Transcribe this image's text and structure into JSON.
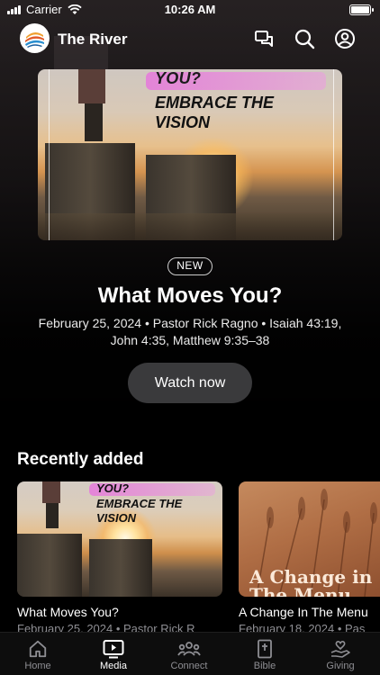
{
  "status": {
    "carrier": "Carrier",
    "time": "10:26 AM"
  },
  "header": {
    "app_title": "The River"
  },
  "hero": {
    "image_text_line1": "YOU?",
    "image_text_line2": "EMBRACE THE VISION",
    "badge": "NEW",
    "title": "What Moves You?",
    "meta": "February 25, 2024 • Pastor Rick Ragno • Isaiah 43:19, John 4:35, Matthew 9:35–38",
    "watch_label": "Watch now"
  },
  "recent": {
    "title": "Recently added",
    "items": [
      {
        "image_text_line1": "YOU?",
        "image_text_line2": "EMBRACE THE VISION",
        "label": "What Moves You?",
        "sub": "February 25, 2024 • Pastor Rick R"
      },
      {
        "image_text": "A Change in The Menu",
        "label": "A Change In The Menu",
        "sub": "February 18, 2024 • Pas"
      }
    ]
  },
  "tabs": [
    {
      "label": "Home",
      "icon": "home-icon"
    },
    {
      "label": "Media",
      "icon": "play-icon",
      "active": true
    },
    {
      "label": "Connect",
      "icon": "group-icon"
    },
    {
      "label": "Bible",
      "icon": "bible-icon"
    },
    {
      "label": "Giving",
      "icon": "giving-icon"
    }
  ]
}
